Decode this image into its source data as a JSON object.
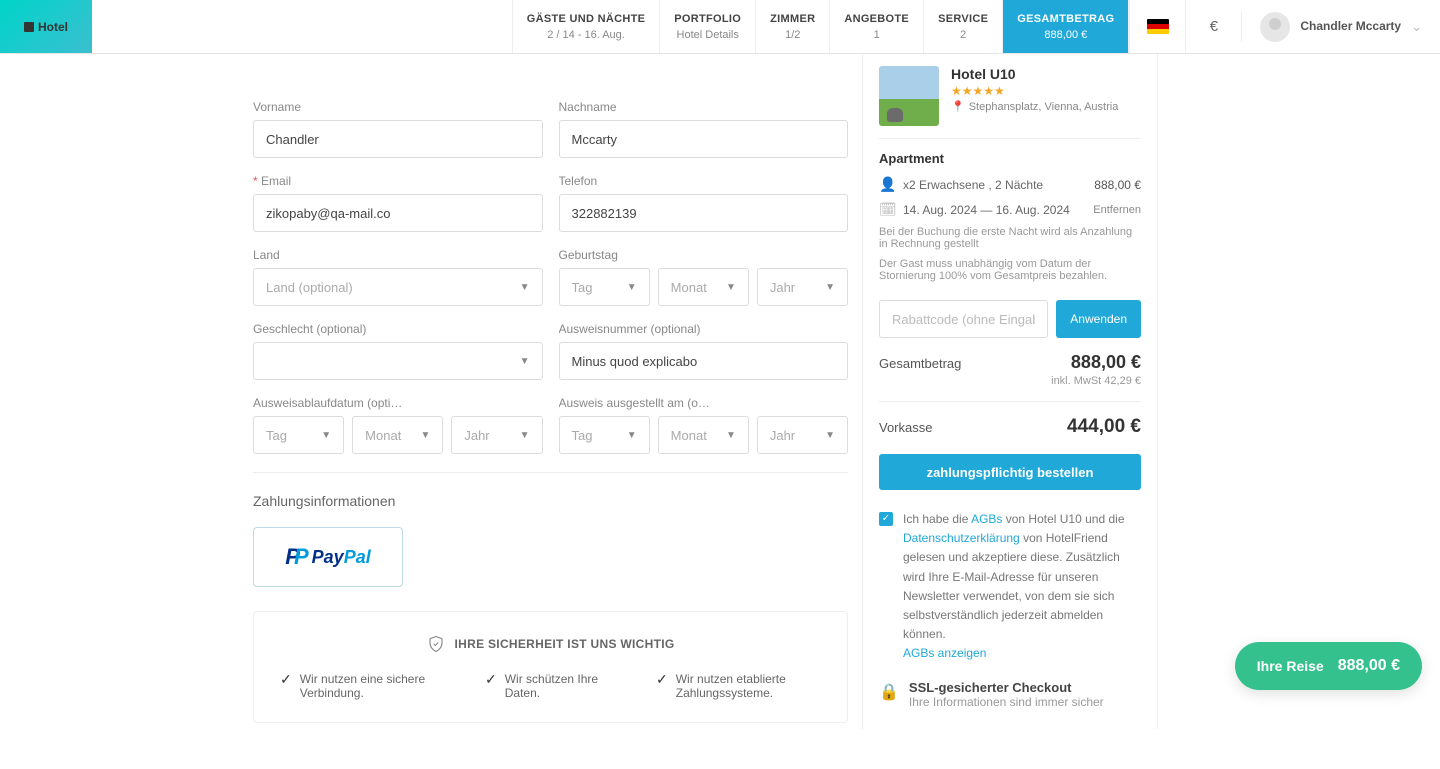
{
  "logo_text": "Hotel",
  "nav": [
    {
      "title": "GÄSTE UND NÄCHTE",
      "sub": "2 / 14 - 16. Aug."
    },
    {
      "title": "PORTFOLIO",
      "sub": "Hotel Details"
    },
    {
      "title": "ZIMMER",
      "sub": "1/2"
    },
    {
      "title": "ANGEBOTE",
      "sub": "1"
    },
    {
      "title": "SERVICE",
      "sub": "2"
    },
    {
      "title": "GESAMTBETRAG",
      "sub": "888,00 €"
    }
  ],
  "currency_symbol": "€",
  "user": {
    "name": "Chandler Mccarty"
  },
  "form": {
    "vorname": {
      "label": "Vorname",
      "value": "Chandler"
    },
    "nachname": {
      "label": "Nachname",
      "value": "Mccarty"
    },
    "email": {
      "label": "Email",
      "value": "zikopaby@qa-mail.co"
    },
    "telefon": {
      "label": "Telefon",
      "value": "322882139"
    },
    "land": {
      "label": "Land",
      "placeholder": "Land (optional)"
    },
    "geburtstag": {
      "label": "Geburtstag"
    },
    "geschlecht": {
      "label": "Geschlecht (optional)"
    },
    "ausweis": {
      "label": "Ausweisnummer (optional)",
      "value": "Minus quod explicabo"
    },
    "ablauf": {
      "label": "Ausweisablaufdatum (opti…"
    },
    "ausgestellt": {
      "label": "Ausweis ausgestellt am (o…"
    },
    "date": {
      "tag": "Tag",
      "monat": "Monat",
      "jahr": "Jahr"
    }
  },
  "payment": {
    "title": "Zahlungsinformationen"
  },
  "security": {
    "title": "IHRE SICHERHEIT IST UNS WICHTIG",
    "items": [
      "Wir nutzen eine sichere Verbindung.",
      "Wir schützen Ihre Daten.",
      "Wir nutzen etablierte Zahlungssysteme."
    ]
  },
  "sidebar": {
    "hotel_name": "Hotel U10",
    "location": "Stephansplatz, Vienna, Austria",
    "apartment": "Apartment",
    "guests": "x2 Erwachsene , 2 Nächte",
    "guests_price": "888,00 €",
    "dates": "14. Aug. 2024 — 16. Aug. 2024",
    "remove": "Entfernen",
    "note1": "Bei der Buchung die erste Nacht wird als Anzahlung in Rechnung gestellt",
    "note2": "Der Gast muss unabhängig vom Datum der Stornierung 100% vom Gesamtpreis bezahlen.",
    "promo_placeholder": "Rabattcode (ohne Eingabe)",
    "apply": "Anwenden",
    "total_label": "Gesamtbetrag",
    "total": "888,00 €",
    "vat": "inkl. MwSt 42,29 €",
    "prepay_label": "Vorkasse",
    "prepay": "444,00 €",
    "order": "zahlungspflichtig bestellen",
    "terms_pre": "Ich habe die ",
    "terms_agb": "AGBs",
    "terms_mid": " von Hotel U10 und die ",
    "terms_priv": "Datenschutzerklärung",
    "terms_post": " von HotelFriend gelesen und akzeptiere diese. Zusätzlich wird Ihre E-Mail-Adresse für unseren Newsletter verwendet, von dem sie sich selbstverständlich jederzeit abmelden können.",
    "terms_show": "AGBs anzeigen",
    "ssl_title": "SSL-gesicherter Checkout",
    "ssl_sub": "Ihre Informationen sind immer sicher"
  },
  "floating": {
    "label": "Ihre Reise",
    "amount": "888,00 €"
  }
}
